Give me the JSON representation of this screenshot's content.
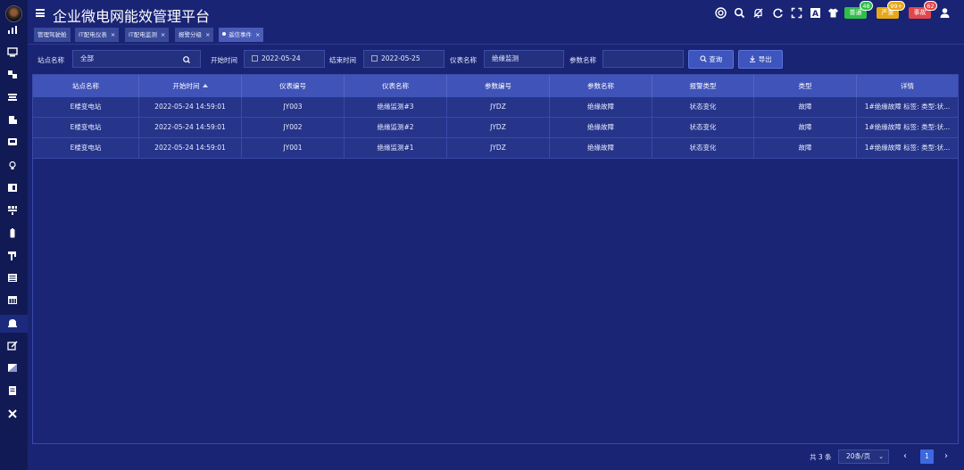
{
  "header": {
    "title": "企业微电网能效管理平台",
    "badges": [
      {
        "label": "普通",
        "count": "48",
        "color": "#2fbf4a",
        "count_color": "#2fbf4a"
      },
      {
        "label": "严重",
        "count": "99+",
        "color": "#e6a817",
        "count_color": "#e6a817"
      },
      {
        "label": "事故",
        "count": "62",
        "color": "#e0474c",
        "count_color": "#e0474c"
      }
    ]
  },
  "tabs": [
    {
      "label": "管理驾驶舱",
      "closable": false,
      "active": false
    },
    {
      "label": "IT配电仪表",
      "close": "×",
      "active": false
    },
    {
      "label": "IT配电监测",
      "close": "×",
      "active": false
    },
    {
      "label": "报警分级",
      "close": "×",
      "active": false
    },
    {
      "label": "遥信事件",
      "close": "×",
      "active": true
    }
  ],
  "filters": {
    "station_label": "站点名称",
    "station_value": "全部",
    "start_label": "开始时间",
    "start_value": "2022-05-24",
    "end_label": "结束时间",
    "end_value": "2022-05-25",
    "meter_label": "仪表名称",
    "meter_value": "绝缘监测",
    "param_label": "参数名称",
    "param_value": "",
    "query_label": "查询",
    "export_label": "导出"
  },
  "table": {
    "columns": [
      "站点名称",
      "开始时间",
      "仪表编号",
      "仪表名称",
      "参数编号",
      "参数名称",
      "报警类型",
      "类型",
      "详情"
    ],
    "rows": [
      [
        "E楼变电站",
        "2022-05-24 14:59:01",
        "JY003",
        "绝缘监测#3",
        "JYDZ",
        "绝缘故障",
        "状态变化",
        "故障",
        "1#绝缘故障 标签: 类型:状..."
      ],
      [
        "E楼变电站",
        "2022-05-24 14:59:01",
        "JY002",
        "绝缘监测#2",
        "JYDZ",
        "绝缘故障",
        "状态变化",
        "故障",
        "1#绝缘故障 标签: 类型:状..."
      ],
      [
        "E楼变电站",
        "2022-05-24 14:59:01",
        "JY001",
        "绝缘监测#1",
        "JYDZ",
        "绝缘故障",
        "状态变化",
        "故障",
        "1#绝缘故障 标签: 类型:状..."
      ]
    ]
  },
  "pagination": {
    "total": "共 3 条",
    "page_size": "20条/页",
    "current": "1",
    "prev": "‹",
    "next": "›"
  },
  "sidebar_icons": [
    "chart-icon",
    "monitor-icon",
    "flow-icon",
    "stack-icon",
    "building-icon",
    "display-icon",
    "bulb-icon",
    "meter-icon",
    "grid-icon",
    "battery-icon",
    "pole-icon",
    "list-icon",
    "calendar-icon",
    "alarm-icon",
    "edit-icon",
    "report-icon",
    "document-icon",
    "tools-icon"
  ]
}
